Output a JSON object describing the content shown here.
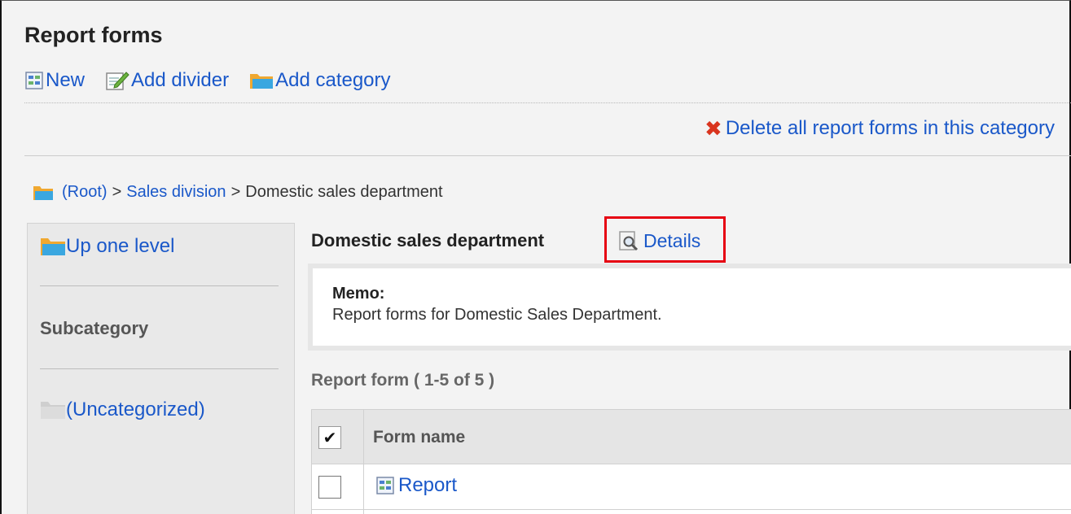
{
  "page": {
    "title": "Report forms"
  },
  "toolbar": {
    "new_label": "New",
    "add_divider_label": "Add divider",
    "add_category_label": "Add category"
  },
  "actions": {
    "delete_all_label": "Delete all report forms in this category"
  },
  "breadcrumb": {
    "root": "(Root)",
    "separator": ">",
    "level1": "Sales division",
    "current": "Domestic sales department"
  },
  "sidebar": {
    "up_label": "Up one level",
    "subcategory_heading": "Subcategory",
    "uncategorized_label": "(Uncategorized)"
  },
  "category": {
    "name": "Domestic sales department",
    "details_label": "Details"
  },
  "memo": {
    "label": "Memo:",
    "text": "Report forms for Domestic Sales Department."
  },
  "list": {
    "heading": "Report form ( 1-5 of 5 )",
    "column_form_name": "Form name",
    "header_check": "✔",
    "rows": [
      {
        "name": "Report"
      }
    ]
  },
  "colors": {
    "link": "#1a58c9",
    "highlight_box": "#e60012",
    "delete_icon": "#d9341e"
  }
}
